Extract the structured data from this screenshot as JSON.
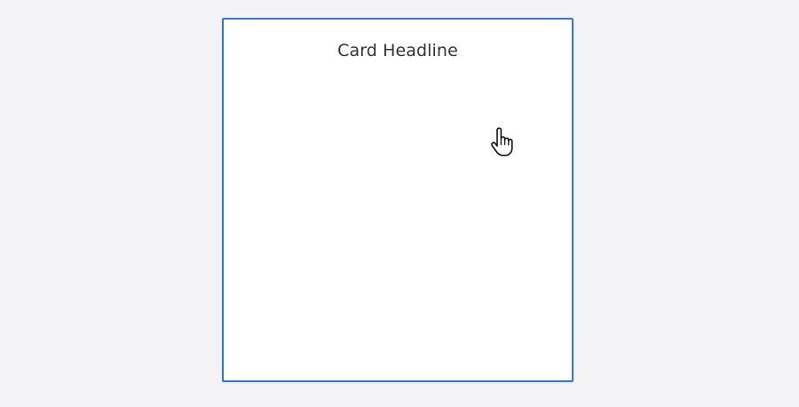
{
  "card": {
    "headline": "Card Headline",
    "accent_color": "#2f7bd4",
    "background_color": "#ffffff"
  },
  "page": {
    "background_color": "#f3f3f5"
  },
  "cursor": {
    "icon": "hand-pointer-icon"
  }
}
